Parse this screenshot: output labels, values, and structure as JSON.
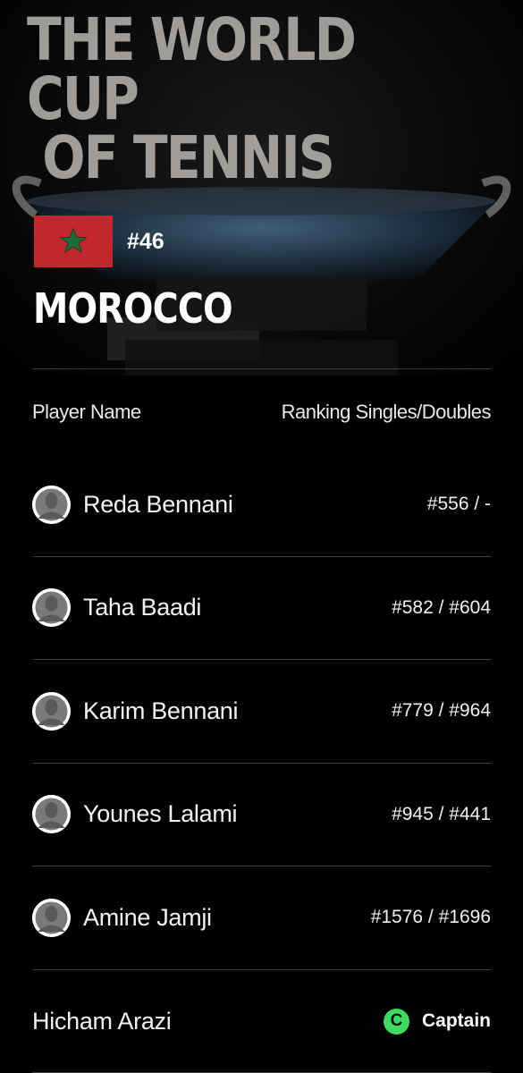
{
  "hero": {
    "title_line1": "THE WORLD CUP",
    "title_line2": "OF TENNIS"
  },
  "team": {
    "flag_icon": "morocco-flag-icon",
    "flag_color": "#c1272d",
    "star_color": "#1f6b35",
    "rank": "#46",
    "country": "MOROCCO"
  },
  "table": {
    "col_player": "Player Name",
    "col_ranking": "Ranking Singles/Doubles"
  },
  "players": [
    {
      "name": "Reda Bennani",
      "ranking": "#556 / -"
    },
    {
      "name": "Taha Baadi",
      "ranking": "#582 / #604"
    },
    {
      "name": "Karim Bennani",
      "ranking": "#779 / #964"
    },
    {
      "name": "Younes Lalami",
      "ranking": "#945 / #441"
    },
    {
      "name": "Amine Jamji",
      "ranking": "#1576 / #1696"
    }
  ],
  "captain": {
    "name": "Hicham Arazi",
    "badge_letter": "C",
    "label": "Captain",
    "badge_color": "#3ddc61"
  }
}
